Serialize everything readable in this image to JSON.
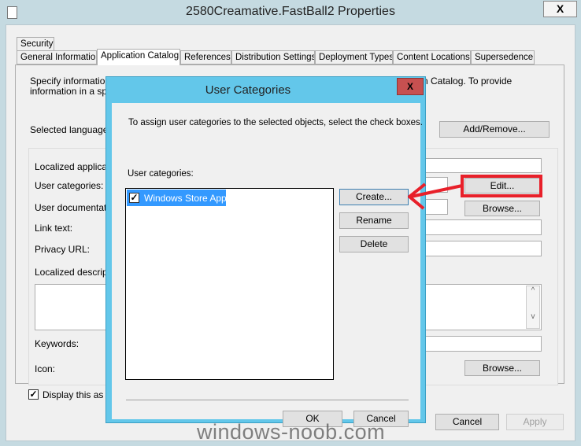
{
  "window": {
    "title": "2580Creamative.FastBall2 Properties",
    "close": "X"
  },
  "tabs": {
    "row1": [
      {
        "label": "Security"
      }
    ],
    "row2": [
      {
        "label": "General Information"
      },
      {
        "label": "Application Catalog",
        "selected": true
      },
      {
        "label": "References"
      },
      {
        "label": "Distribution Settings"
      },
      {
        "label": "Deployment Types"
      },
      {
        "label": "Content Locations"
      },
      {
        "label": "Supersedence"
      }
    ]
  },
  "panel": {
    "intro1": "Specify information a",
    "intro1_end": "n Catalog. To provide",
    "intro2": "information in a spec",
    "selected_language": "Selected language:",
    "add_remove": "Add/Remove...",
    "labels": {
      "localized_app": "Localized applicatio",
      "user_categories": "User categories:",
      "user_doc": "User documentatio",
      "link_text": "Link text:",
      "privacy_url": "Privacy URL:",
      "localized_desc": "Localized descriptio",
      "keywords": "Keywords:",
      "icon": "Icon:"
    },
    "edit": "Edit...",
    "browse": "Browse...",
    "display_checkbox": {
      "label": "Display this as a f",
      "checked": true
    }
  },
  "footer": {
    "cancel": "Cancel",
    "apply": "Apply"
  },
  "dialog": {
    "title": "User Categories",
    "close": "X",
    "instruction": "To assign user categories to the selected objects, select the check boxes.",
    "list_label": "User categories:",
    "items": [
      {
        "label": "Windows Store Apps",
        "checked": true,
        "selected": true
      }
    ],
    "create": "Create...",
    "rename": "Rename",
    "delete": "Delete",
    "ok": "OK",
    "cancel": "Cancel"
  },
  "watermark": "windows-noob.com",
  "colors": {
    "dialog_frame": "#63c7ea",
    "selection": "#3399ff",
    "annotation": "#e8202a",
    "close_red": "#c75050"
  }
}
